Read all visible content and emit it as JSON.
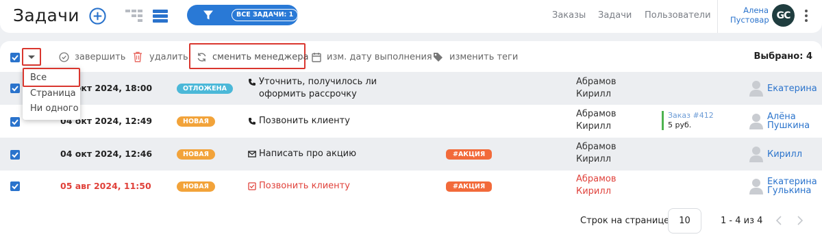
{
  "header": {
    "title": "Задачи",
    "filter_count": "ВСЕ ЗАДАЧИ: 1",
    "nav": [
      "Заказы",
      "Задачи",
      "Пользователи"
    ],
    "user_first": "Алена",
    "user_last": "Пустовар",
    "avatar_initials": "GC"
  },
  "toolbar": {
    "complete": "завершить",
    "delete": "удалить",
    "change_manager": "сменить менеджера",
    "change_date": "изм. дату выполнения",
    "change_tags": "изменить теги",
    "selected": "Выбрано: 4"
  },
  "select_menu": [
    "Все",
    "Страница",
    "Ни одного"
  ],
  "rows": [
    {
      "date": "04 окт 2024, 18:00",
      "status": "ОТЛОЖЕНА",
      "status_color": "#4bb8d8",
      "task": "Уточнить, получилось ли оформить рассрочку",
      "task_icon": "phone-icon",
      "tag": "",
      "manager": "Абрамов Кирилл",
      "order": "",
      "sum": "",
      "executor": "Екатерина",
      "overdue": false
    },
    {
      "date": "04 окт 2024, 12:49",
      "status": "НОВАЯ",
      "status_color": "#f2a33a",
      "task": "Позвонить клиенту",
      "task_icon": "phone-icon",
      "tag": "",
      "manager": "Абрамов Кирилл",
      "order": "Заказ #412",
      "sum": "5 руб.",
      "executor": "Алёна Пушкина",
      "overdue": false
    },
    {
      "date": "04 окт 2024, 12:46",
      "status": "НОВАЯ",
      "status_color": "#f2a33a",
      "task": "Написать про акцию",
      "task_icon": "mail-icon",
      "tag": "#АКЦИЯ",
      "manager": "Абрамов Кирилл",
      "order": "",
      "sum": "",
      "executor": "Кирилл",
      "overdue": false
    },
    {
      "date": "05 авг 2024, 11:50",
      "status": "НОВАЯ",
      "status_color": "#f2a33a",
      "task": "Позвонить клиенту",
      "task_icon": "checkbox-icon",
      "tag": "#АКЦИЯ",
      "manager": "Абрамов Кирилл",
      "order": "",
      "sum": "",
      "executor": "Екатерина Гулькина",
      "overdue": true
    }
  ],
  "footer": {
    "rows_label": "Строк на странице:",
    "per_page": "10",
    "range": "1 - 4 из 4"
  },
  "colors": {
    "accent": "#2a73cc",
    "highlight": "#d9362e",
    "tag": "#f26a3a"
  }
}
